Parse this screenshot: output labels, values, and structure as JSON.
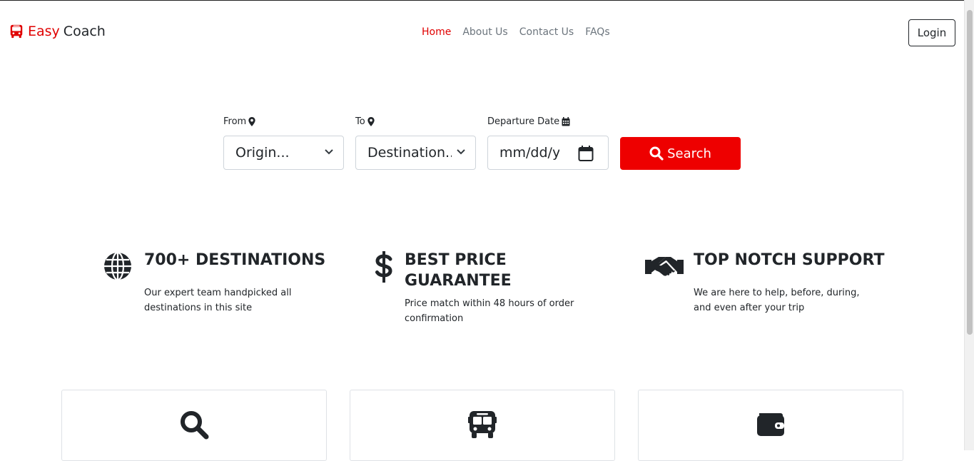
{
  "brand": {
    "part1": "Easy",
    "part2": "Coach",
    "icon": "bus-icon",
    "accent": "#e00000"
  },
  "nav": {
    "links": [
      {
        "label": "Home",
        "active": true
      },
      {
        "label": "About Us",
        "active": false
      },
      {
        "label": "Contact Us",
        "active": false
      },
      {
        "label": "FAQs",
        "active": false
      }
    ],
    "login_label": "Login"
  },
  "search": {
    "from_label": "From",
    "from_value": "Origin...",
    "to_label": "To",
    "to_value": "Destination...",
    "date_label": "Departure Date",
    "date_value": "mm/dd/yyyy",
    "button_label": "Search",
    "button_color": "#ee0000"
  },
  "features": [
    {
      "icon": "globe-icon",
      "title": "700+ DESTINATIONS",
      "text": "Our expert team handpicked all destinations in this site"
    },
    {
      "icon": "dollar-icon",
      "title_line1": "BEST PRICE",
      "title_line2": "GUARANTEE",
      "text": "Price match within 48 hours of order confirmation"
    },
    {
      "icon": "handshake-icon",
      "title": "TOP NOTCH SUPPORT",
      "text": "We are here to help, before, during, and even after your trip"
    }
  ],
  "cards": [
    {
      "icon": "search-icon"
    },
    {
      "icon": "bus-icon"
    },
    {
      "icon": "wallet-icon"
    }
  ]
}
